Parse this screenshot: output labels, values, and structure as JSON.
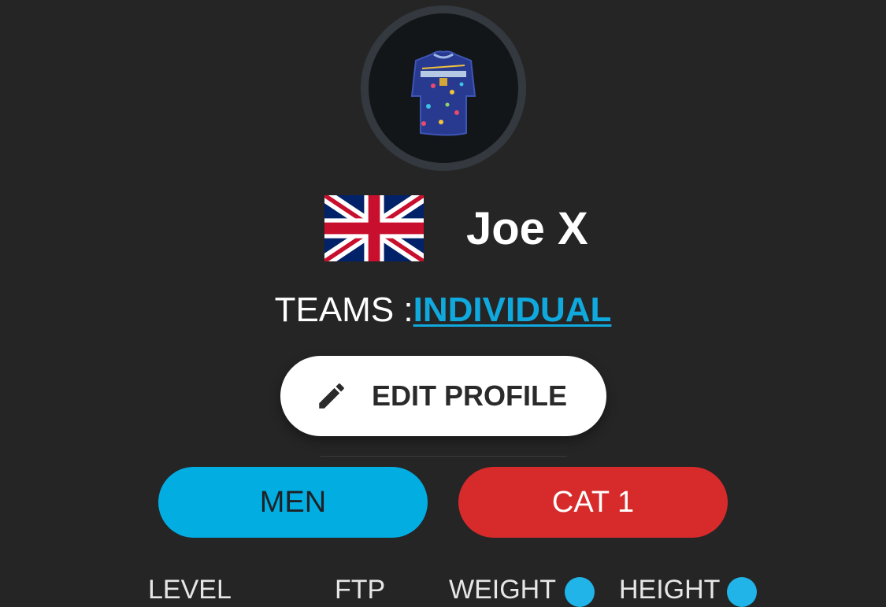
{
  "profile": {
    "avatar_icon": "cycling-jersey-icon",
    "country_flag_icon": "uk-flag-icon",
    "name": "Joe X"
  },
  "teams": {
    "label": "TEAMS :",
    "value": "INDIVIDUAL"
  },
  "actions": {
    "edit_icon": "pencil-icon",
    "edit_label": "EDIT PROFILE"
  },
  "badges": {
    "gender": "MEN",
    "category": "CAT 1"
  },
  "stats": {
    "labels": [
      "LEVEL",
      "FTP",
      "WEIGHT",
      "HEIGHT"
    ]
  },
  "colors": {
    "background": "#252525",
    "accent_blue": "#02ade2",
    "link_blue": "#10a9de",
    "category_red": "#d72b2b"
  }
}
